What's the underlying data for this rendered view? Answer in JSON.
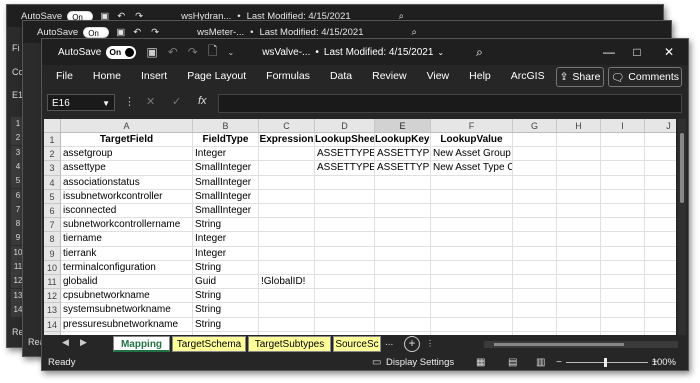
{
  "back_window_1": {
    "autosave_label": "AutoSave",
    "toggle_label": "On",
    "filename": "wsHydran...",
    "modified": "Last Modified: 4/15/2021",
    "side_labels": [
      "Fi",
      "Co",
      "E1"
    ],
    "row_numbers": [
      "1",
      "2",
      "3",
      "4",
      "5",
      "6",
      "7",
      "8",
      "9",
      "10",
      "11",
      "12",
      "13",
      "14"
    ],
    "status_text": "Re"
  },
  "back_window_2": {
    "autosave_label": "AutoSave",
    "toggle_label": "On",
    "filename": "wsMeter-...",
    "modified": "Last Modified: 4/15/2021",
    "status_text": "Rea"
  },
  "main_window": {
    "autosave_label": "AutoSave",
    "toggle_label": "On",
    "filename": "wsValve-...",
    "separator": "•",
    "modified": "Last Modified: 4/15/2021",
    "dropdown": "⌄",
    "window_controls": [
      "—",
      "□",
      "✕"
    ]
  },
  "menu": [
    "File",
    "Home",
    "Insert",
    "Page Layout",
    "Formulas",
    "Data",
    "Review",
    "View",
    "Help",
    "ArcGIS"
  ],
  "share_label": "Share",
  "comments_label": "Comments",
  "formula_bar": {
    "name_box": "E16",
    "fx": "fx",
    "value": ""
  },
  "sheet": {
    "columns": [
      "A",
      "B",
      "C",
      "D",
      "E",
      "F",
      "G",
      "H",
      "I",
      "J"
    ],
    "selected_column": "E",
    "rows": [
      [
        "TargetField",
        "FieldType",
        "Expression",
        "LookupSheet",
        "LookupKeys",
        "LookupValue",
        "",
        "",
        "",
        ""
      ],
      [
        "assetgroup",
        "Integer",
        "",
        "ASSETTYPE",
        "ASSETTYPE",
        "New Asset Group Code",
        "",
        "",
        "",
        ""
      ],
      [
        "assettype",
        "SmallInteger",
        "",
        "ASSETTYPE",
        "ASSETTYPE",
        "New Asset Type Code",
        "",
        "",
        "",
        ""
      ],
      [
        "associationstatus",
        "SmallInteger",
        "",
        "",
        "",
        "",
        "",
        "",
        "",
        ""
      ],
      [
        "issubnetworkcontroller",
        "SmallInteger",
        "",
        "",
        "",
        "",
        "",
        "",
        "",
        ""
      ],
      [
        "isconnected",
        "SmallInteger",
        "",
        "",
        "",
        "",
        "",
        "",
        "",
        ""
      ],
      [
        "subnetworkcontrollername",
        "String",
        "",
        "",
        "",
        "",
        "",
        "",
        "",
        ""
      ],
      [
        "tiername",
        "Integer",
        "",
        "",
        "",
        "",
        "",
        "",
        "",
        ""
      ],
      [
        "tierrank",
        "Integer",
        "",
        "",
        "",
        "",
        "",
        "",
        "",
        ""
      ],
      [
        "terminalconfiguration",
        "String",
        "",
        "",
        "",
        "",
        "",
        "",
        "",
        ""
      ],
      [
        "globalid",
        "Guid",
        "!GlobalID!",
        "",
        "",
        "",
        "",
        "",
        "",
        ""
      ],
      [
        "cpsubnetworkname",
        "String",
        "",
        "",
        "",
        "",
        "",
        "",
        "",
        ""
      ],
      [
        "systemsubnetworkname",
        "String",
        "",
        "",
        "",
        "",
        "",
        "",
        "",
        ""
      ],
      [
        "pressuresubnetworkname",
        "String",
        "",
        "",
        "",
        "",
        "",
        "",
        "",
        ""
      ]
    ],
    "row_numbers": [
      "1",
      "2",
      "3",
      "4",
      "5",
      "6",
      "7",
      "8",
      "9",
      "10",
      "11",
      "12",
      "13",
      "14",
      "15"
    ]
  },
  "tabs": [
    "Mapping",
    "TargetSchema",
    "TargetSubtypes",
    "SourceSc"
  ],
  "active_tab": "Mapping",
  "tabs_more": "...",
  "status": {
    "ready": "Ready",
    "display_settings": "Display Settings",
    "zoom": "100%"
  },
  "colors": {
    "tab_yellow": "#ffff99",
    "active_tab_green": "#217346",
    "chrome_dark": "#262626"
  }
}
